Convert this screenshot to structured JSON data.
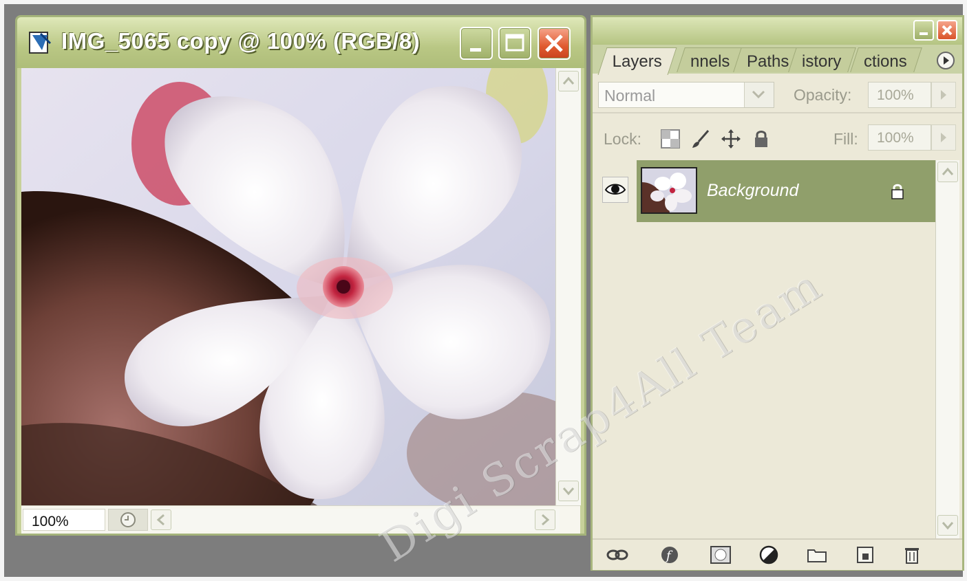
{
  "document_window": {
    "title": "IMG_5065 copy @ 100% (RGB/8)",
    "zoom": "100%"
  },
  "layers_palette": {
    "tabs": [
      {
        "label": "Layers",
        "active": true
      },
      {
        "label": "nnels",
        "active": false
      },
      {
        "label": "Paths",
        "active": false
      },
      {
        "label": "istory",
        "active": false
      },
      {
        "label": "ctions",
        "active": false
      }
    ],
    "blend_mode": "Normal",
    "opacity_label": "Opacity:",
    "opacity_value": "100%",
    "lock_label": "Lock:",
    "fill_label": "Fill:",
    "fill_value": "100%",
    "layers": [
      {
        "name": "Background",
        "visible": true,
        "locked": true,
        "selected": true
      }
    ],
    "lock_icons": [
      "transparency-lock-icon",
      "brush-lock-icon",
      "move-lock-icon",
      "padlock-icon"
    ],
    "footer_icons": [
      "link-icon",
      "layer-style-icon",
      "mask-icon",
      "adjustment-layer-icon",
      "folder-icon",
      "new-layer-icon",
      "trash-icon"
    ]
  },
  "watermark": "Digi Scrap4All Team",
  "colors": {
    "window_frame": "#c7d19a",
    "selected_layer": "#909f6b",
    "palette_bg": "#ece9d8",
    "close_button": "#e05a2f"
  }
}
